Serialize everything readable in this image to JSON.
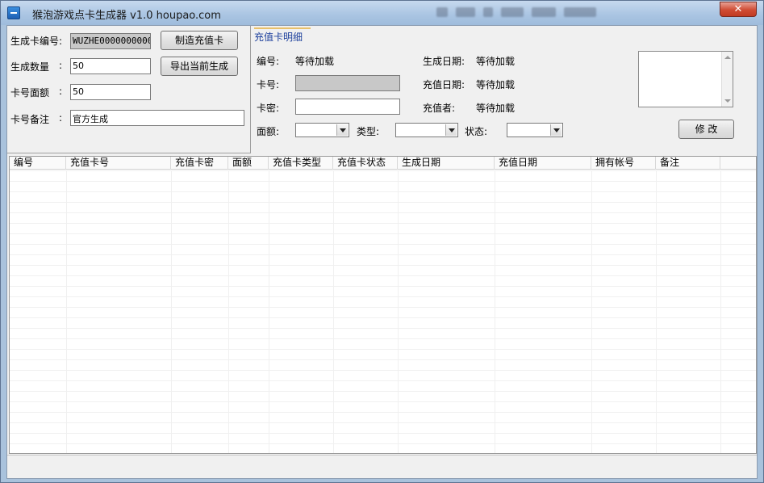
{
  "window": {
    "title": "猴泡游戏点卡生成器 v1.0   houpao.com",
    "close_label": "✕"
  },
  "left": {
    "card_no_label": "生成卡编号:",
    "card_no_value": "WUZHE0000000000",
    "qty_label": "生成数量",
    "qty_colon": ":",
    "qty_value": "50",
    "denom_label": "卡号面额",
    "denom_colon": ":",
    "denom_value": "50",
    "remark_label": "卡号备注",
    "remark_colon": ":",
    "remark_value": "官方生成",
    "make_button": "制造充值卡",
    "export_button": "导出当前生成"
  },
  "detail": {
    "tab_label": "充值卡明细",
    "no_label": "编号:",
    "no_value": "等待加载",
    "created_label": "生成日期:",
    "created_value": "等待加载",
    "card_label": "卡号:",
    "card_value": "",
    "recharge_date_label": "充值日期:",
    "recharge_date_value": "等待加载",
    "pwd_label": "卡密:",
    "pwd_value": "",
    "recharger_label": "充值者:",
    "recharger_value": "等待加载",
    "face_label": "面额:",
    "type_label": "类型:",
    "status_label": "状态:",
    "modify_button": "修 改"
  },
  "table": {
    "columns": [
      "编号",
      "充值卡号",
      "充值卡密",
      "面额",
      "充值卡类型",
      "充值卡状态",
      "生成日期",
      "充值日期",
      "拥有帐号",
      "备注"
    ],
    "rows": []
  }
}
